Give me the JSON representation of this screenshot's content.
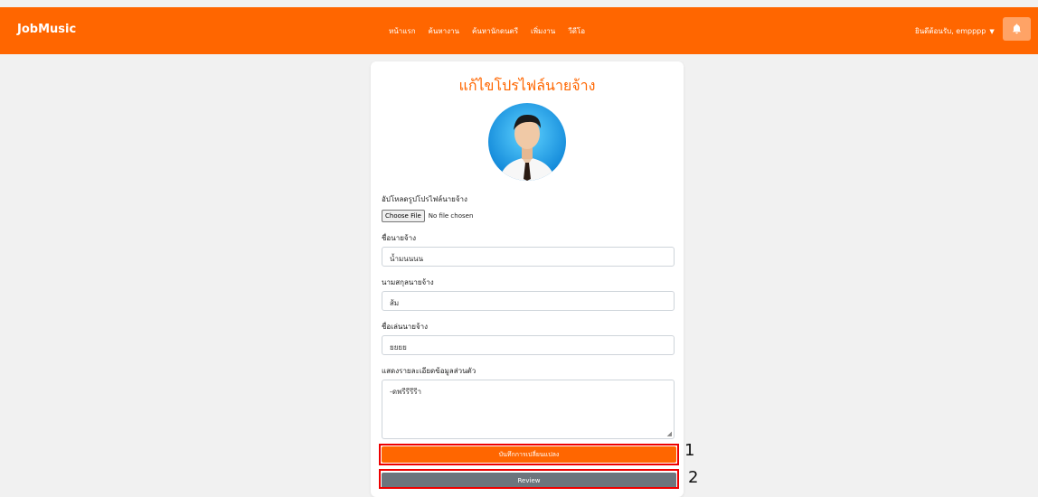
{
  "navbar": {
    "brand": "JobMusic",
    "links": [
      "หน้าแรก",
      "ค้นหางาน",
      "ค้นหานักดนตรี",
      "เพิ่มงาน",
      "วีดีโอ"
    ],
    "user_label": "ยินดีต้อนรับ, empppp",
    "bell_color": "#ffa366",
    "accent": "#ff6600"
  },
  "form": {
    "title": "แก้ไขโปรไฟล์นายจ้าง",
    "upload_label": "อัปโหลดรูปโปรไฟล์นายจ้าง",
    "choose_file": "Choose File",
    "no_file": "No file chosen",
    "first_name_label": "ชื่อนายจ้าง",
    "first_name_value": "น้ำมนนนน",
    "last_name_label": "นามสกุลนายจ้าง",
    "last_name_value": "ส้ม",
    "nickname_label": "ชื่อเล่นนายจ้าง",
    "nickname_value": "ยยยย",
    "detail_label": "แสดงรายละเอียดข้อมูลส่วนตัว",
    "detail_value": "-ดพรีรีรีรีา",
    "save_button": "บันทึกการเปลี่ยนแปลง",
    "review_button": "Review"
  },
  "annotations": [
    "1",
    "2"
  ]
}
